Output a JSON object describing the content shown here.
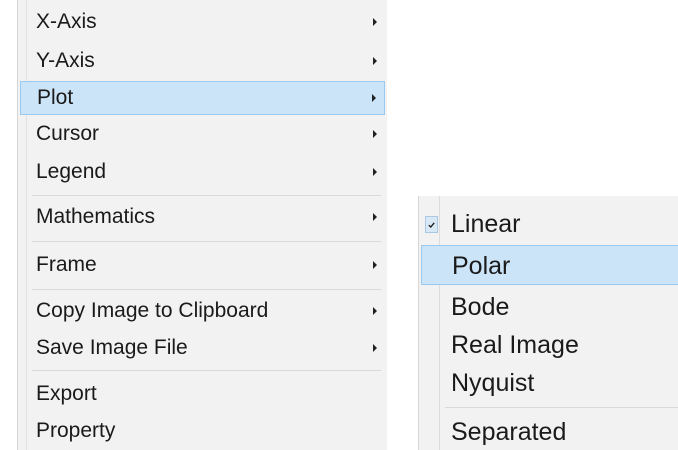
{
  "main_menu": {
    "items": [
      {
        "label": "X-Axis",
        "has_submenu": true
      },
      {
        "label": "Y-Axis",
        "has_submenu": true
      },
      {
        "label": "Plot",
        "has_submenu": true,
        "highlighted": true
      },
      {
        "label": "Cursor",
        "has_submenu": true
      },
      {
        "label": "Legend",
        "has_submenu": true
      },
      {
        "label": "Mathematics",
        "has_submenu": true
      },
      {
        "label": "Frame",
        "has_submenu": true
      },
      {
        "label": "Copy Image to Clipboard",
        "has_submenu": true
      },
      {
        "label": "Save Image File",
        "has_submenu": true
      },
      {
        "label": "Export",
        "has_submenu": false
      },
      {
        "label": "Property",
        "has_submenu": false
      }
    ]
  },
  "plot_submenu": {
    "items": [
      {
        "label": "Linear",
        "checked": true
      },
      {
        "label": "Polar",
        "highlighted": true
      },
      {
        "label": "Bode"
      },
      {
        "label": "Real Image"
      },
      {
        "label": "Nyquist"
      },
      {
        "label": "Separated"
      }
    ]
  },
  "colors": {
    "menu_background": "#f2f2f2",
    "highlight_fill": "#cce4f7",
    "highlight_border": "#99c9ef"
  }
}
